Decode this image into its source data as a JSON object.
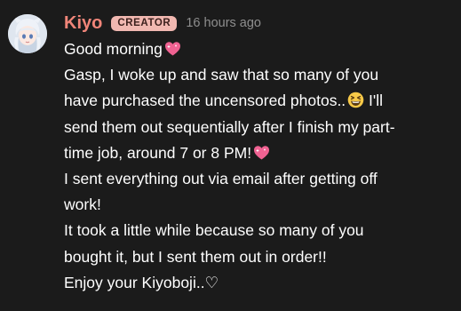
{
  "post": {
    "author": "Kiyo",
    "badge": "CREATOR",
    "timestamp": "16 hours ago",
    "avatar_icon": "anime-character-avatar",
    "lines": [
      {
        "text": "Good morning",
        "emoji": "sparkling-heart-icon"
      },
      {
        "text": "Gasp, I woke up and saw that so many of you"
      },
      {
        "text": "have purchased the uncensored photos..",
        "emoji": "grinning-squinting-face-icon",
        "after": " I'll"
      },
      {
        "text": "send them out sequentially after I finish my part-"
      },
      {
        "text": "time job, around 7 or 8 PM!",
        "emoji": "sparkling-heart-icon"
      },
      {
        "text": "I sent everything out via email after getting off"
      },
      {
        "text": "work!"
      },
      {
        "text": "It took a little while because so many of you"
      },
      {
        "text": "bought it, but I sent them out in order!!"
      },
      {
        "text": "Enjoy your Kiyoboji..♡"
      }
    ]
  },
  "colors": {
    "background": "#1b1b1b",
    "author": "#f08579",
    "badge_bg": "#f1b8b1",
    "badge_text": "#3b1f1c",
    "timestamp": "#8e8e8e",
    "text": "#ffffff",
    "heart": "#f06292"
  }
}
